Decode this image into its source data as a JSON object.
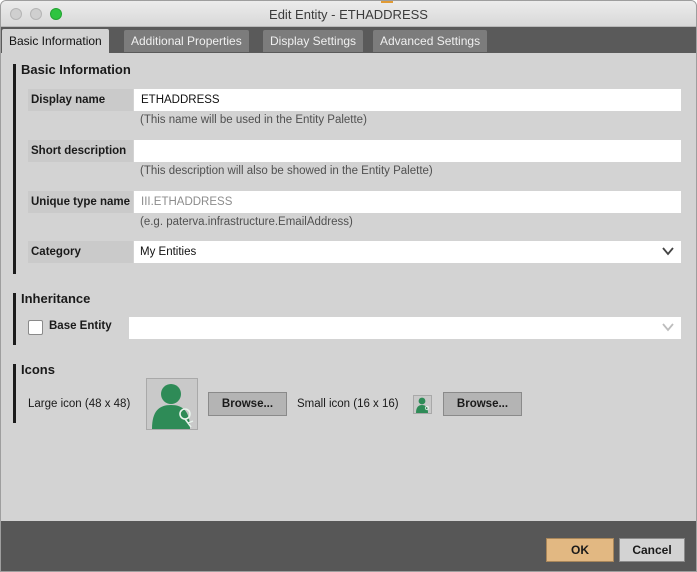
{
  "window": {
    "title": "Edit Entity - ETHADDRESS"
  },
  "tabs": [
    {
      "label": "Basic Information",
      "active": true
    },
    {
      "label": "Additional Properties",
      "active": false
    },
    {
      "label": "Display Settings",
      "active": false
    },
    {
      "label": "Advanced Settings",
      "active": false
    }
  ],
  "basic_info": {
    "section_title": "Basic Information",
    "display_name": {
      "label": "Display name",
      "value": "ETHADDRESS",
      "hint": "(This name will be used in the Entity Palette)"
    },
    "short_description": {
      "label": "Short description",
      "value": "",
      "hint": "(This description will also be showed in the Entity Palette)"
    },
    "unique_type_name": {
      "label": "Unique type name",
      "value": "III.ETHADDRESS",
      "hint": "(e.g. paterva.infrastructure.EmailAddress)"
    },
    "category": {
      "label": "Category",
      "value": "My Entities"
    }
  },
  "inheritance": {
    "section_title": "Inheritance",
    "base_entity_label": "Base Entity",
    "base_entity_checked": false,
    "base_entity_value": ""
  },
  "icons": {
    "section_title": "Icons",
    "large_label": "Large icon (48 x 48)",
    "small_label": "Small icon (16 x 16)",
    "browse_label": "Browse...",
    "icon_color": "#2e8b57"
  },
  "footer": {
    "ok_label": "OK",
    "cancel_label": "Cancel"
  },
  "colors": {
    "ok_button": "#e2b882",
    "tab_strip": "#5a5a5a",
    "footer": "#575757"
  }
}
